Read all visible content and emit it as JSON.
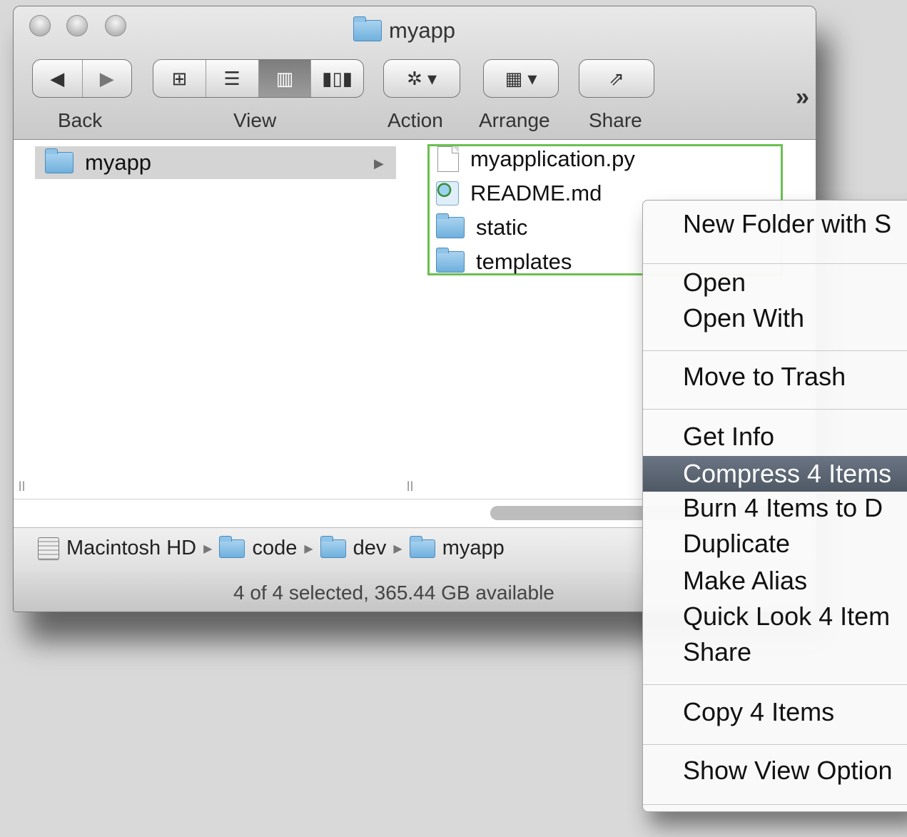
{
  "window": {
    "title": "myapp",
    "folder_icon": "folder-icon"
  },
  "toolbar": {
    "back_label": "Back",
    "view_label": "View",
    "action_label": "Action",
    "arrange_label": "Arrange",
    "share_label": "Share",
    "overflow_label": "»"
  },
  "columns": {
    "first": {
      "items": [
        {
          "name": "myapp",
          "icon": "folder-icon"
        }
      ]
    },
    "second": {
      "items": [
        {
          "name": "myapplication.py",
          "icon": "document-icon"
        },
        {
          "name": "README.md",
          "icon": "markdown-file-icon"
        },
        {
          "name": "static",
          "icon": "folder-icon"
        },
        {
          "name": "templates",
          "icon": "folder-icon"
        }
      ]
    }
  },
  "pathbar": {
    "items": [
      "Macintosh HD",
      "code",
      "dev",
      "myapp"
    ]
  },
  "status": {
    "text": "4 of 4 selected, 365.44 GB available"
  },
  "context_menu": {
    "items": [
      "New Folder with S",
      "Open",
      "Open With",
      "Move to Trash",
      "Get Info",
      "Compress 4 Items",
      "Burn 4 Items to D",
      "Duplicate",
      "Make Alias",
      "Quick Look 4 Item",
      "Share",
      "Copy 4 Items",
      "Show View Option"
    ],
    "highlighted": "Compress 4 Items"
  },
  "colors": {
    "selection_outline": "#6ac04f",
    "menu_highlight": "#5b6572",
    "selected_row": "#d4d4d4"
  }
}
